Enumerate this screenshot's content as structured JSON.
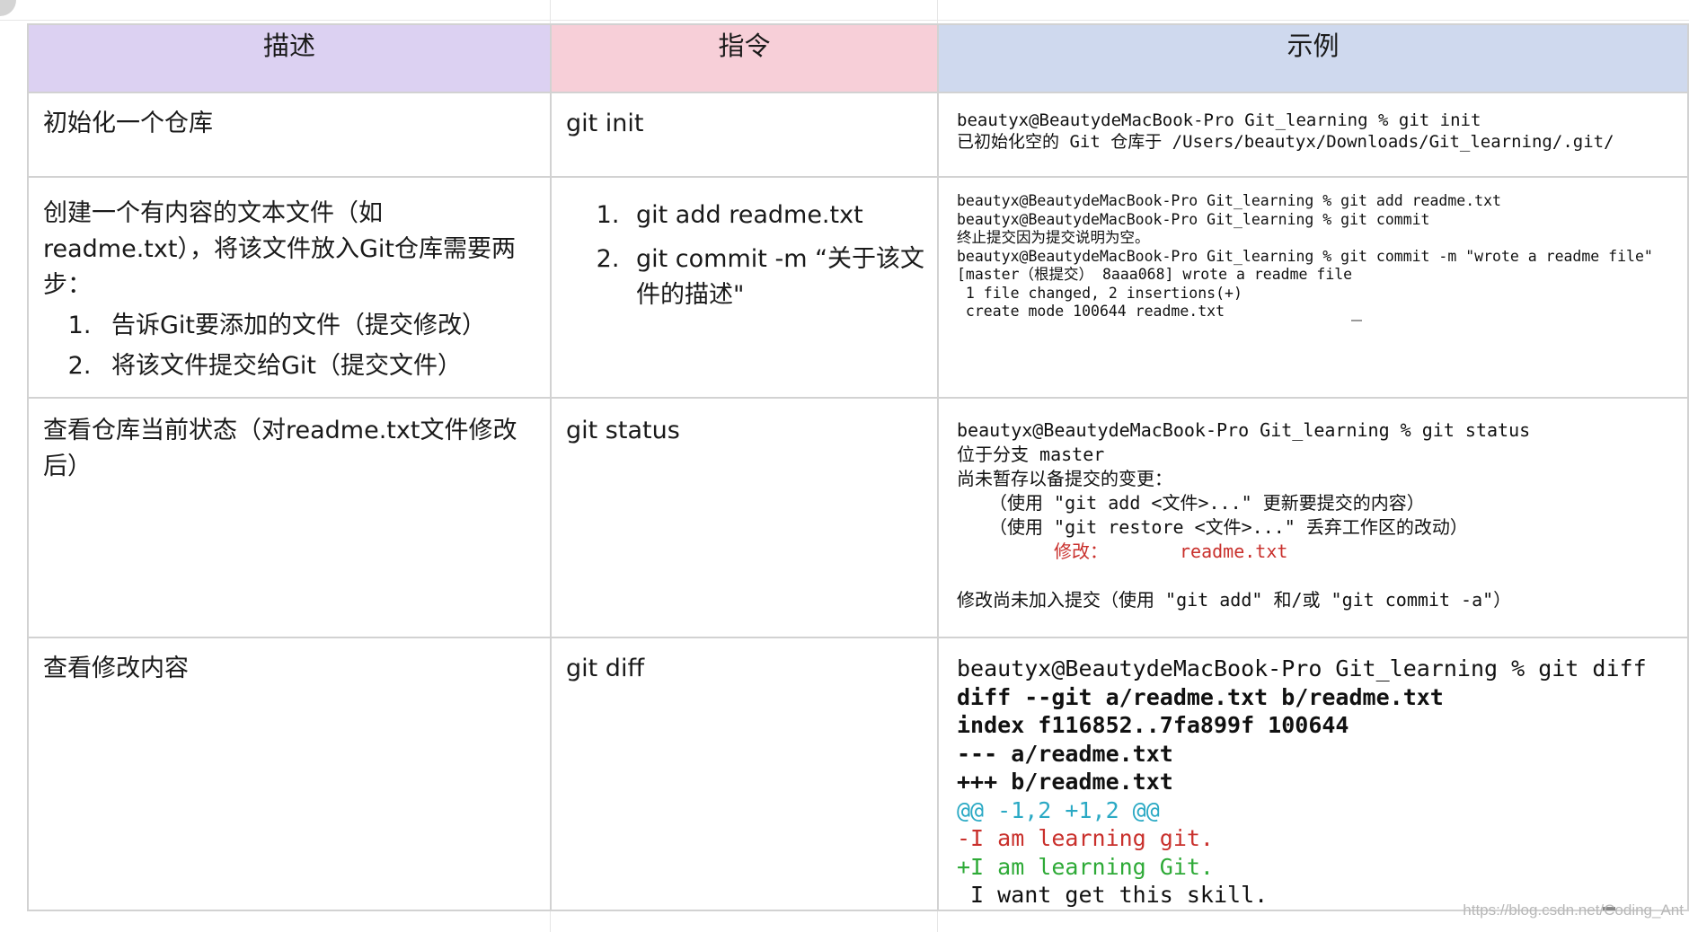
{
  "table": {
    "headers": {
      "description": "描述",
      "command": "指令",
      "example": "示例"
    },
    "rows": [
      {
        "description": "初始化一个仓库",
        "command": "git init",
        "terminal": [
          "beautyx@BeautydeMacBook-Pro Git_learning % git init",
          "已初始化空的 Git 仓库于 /Users/beautyx/Downloads/Git_learning/.git/"
        ]
      },
      {
        "description": "创建一个有内容的文本文件（如readme.txt），将该文件放入Git仓库需要两步：",
        "steps": [
          "告诉Git要添加的文件（提交修改）",
          "将该文件提交给Git（提交文件）"
        ],
        "commands": [
          "git add readme.txt",
          "git commit -m “关于该文件的描述\""
        ],
        "terminal": [
          "beautyx@BeautydeMacBook-Pro Git_learning % git add readme.txt",
          "beautyx@BeautydeMacBook-Pro Git_learning % git commit",
          "终止提交因为提交说明为空。",
          "beautyx@BeautydeMacBook-Pro Git_learning % git commit -m \"wrote a readme file\"",
          "[master（根提交） 8aaa068] wrote a readme file",
          " 1 file changed, 2 insertions(+)",
          " create mode 100644 readme.txt"
        ]
      },
      {
        "description": "查看仓库当前状态（对readme.txt文件修改后）",
        "command": "git status",
        "terminal": {
          "line1": "beautyx@BeautydeMacBook-Pro Git_learning % git status",
          "line2": "位于分支 master",
          "line3": "尚未暂存以备提交的变更：",
          "line4": "（使用 \"git add <文件>...\" 更新要提交的内容）",
          "line5": "（使用 \"git restore <文件>...\" 丢弃工作区的改动）",
          "modified_label": "修改：",
          "modified_file": "readme.txt",
          "line7": "修改尚未加入提交（使用 \"git add\" 和/或 \"git commit -a\"）"
        }
      },
      {
        "description": "查看修改内容",
        "command": "git diff",
        "terminal": {
          "prompt": "beautyx@BeautydeMacBook-Pro Git_learning % git diff",
          "header1": "diff --git a/readme.txt b/readme.txt",
          "header2": "index f116852..7fa899f 100644",
          "header3": "--- a/readme.txt",
          "header4": "+++ b/readme.txt",
          "hunk": "@@ -1,2 +1,2 @@",
          "removed": "-I am learning git.",
          "added": "+I am learning Git.",
          "context": " I want get this skill."
        }
      }
    ]
  },
  "watermark": "https://blog.csdn.net/Coding_Ant",
  "colors": {
    "header_desc_bg": "#dcd1f2",
    "header_cmd_bg": "#f7cfd8",
    "header_ex_bg": "#cfd9ee",
    "diff_removed": "#c9302c",
    "diff_added": "#2eaa37",
    "diff_hunk": "#2aa9c4"
  }
}
